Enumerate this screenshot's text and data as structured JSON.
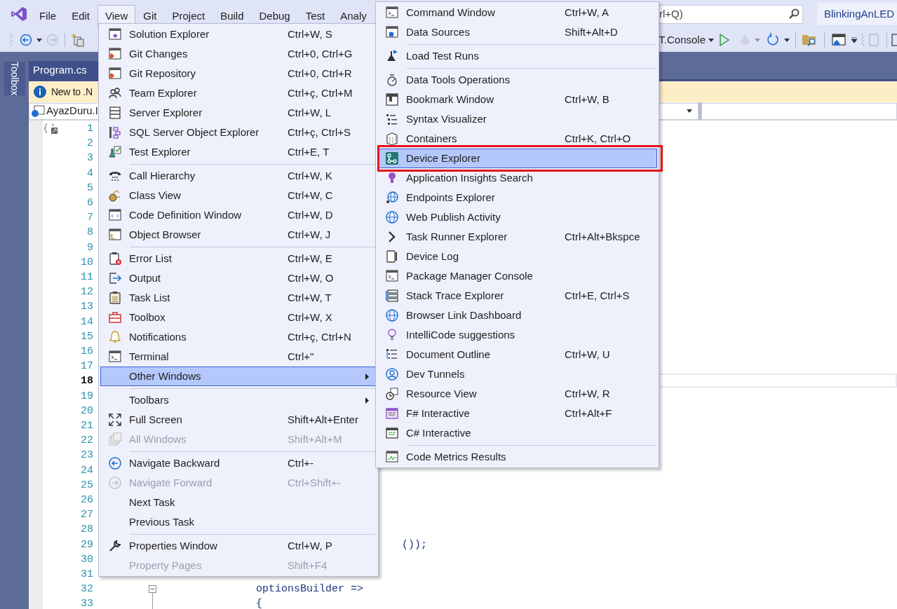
{
  "menu_bar": [
    {
      "label": "File",
      "selected": false
    },
    {
      "label": "Edit",
      "selected": false
    },
    {
      "label": "View",
      "selected": true
    },
    {
      "label": "Git",
      "selected": false
    },
    {
      "label": "Project",
      "selected": false
    },
    {
      "label": "Build",
      "selected": false
    },
    {
      "label": "Debug",
      "selected": false
    },
    {
      "label": "Test",
      "selected": false
    },
    {
      "label": "Analy",
      "selected": false
    }
  ],
  "search": {
    "placeholder": "rl+Q)"
  },
  "solution_name": "BlinkingAnLED",
  "toolbar": {
    "startup_project": "T.Console"
  },
  "side_tab": "Toolbox",
  "document_tab": {
    "label": "Program.cs",
    "selected": true
  },
  "info_bar": {
    "text": "New to .N"
  },
  "navigation_bar": {
    "project": "AyazDuru.I"
  },
  "editor": {
    "lines": [
      {
        "number": "1",
        "current": false
      },
      {
        "number": "2",
        "current": false
      },
      {
        "number": "3",
        "current": false
      },
      {
        "number": "4",
        "current": false
      },
      {
        "number": "5",
        "current": false
      },
      {
        "number": "6",
        "current": false
      },
      {
        "number": "7",
        "current": false
      },
      {
        "number": "8",
        "current": false
      },
      {
        "number": "9",
        "current": false
      },
      {
        "number": "10",
        "current": false
      },
      {
        "number": "11",
        "current": false
      },
      {
        "number": "12",
        "current": false
      },
      {
        "number": "13",
        "current": false
      },
      {
        "number": "14",
        "current": false
      },
      {
        "number": "15",
        "current": false
      },
      {
        "number": "16",
        "current": false
      },
      {
        "number": "17",
        "current": false
      },
      {
        "number": "18",
        "current": true
      },
      {
        "number": "19",
        "current": false
      },
      {
        "number": "20",
        "current": false
      },
      {
        "number": "21",
        "current": false
      },
      {
        "number": "22",
        "current": false
      },
      {
        "number": "23",
        "current": false
      },
      {
        "number": "24",
        "current": false
      },
      {
        "number": "25",
        "current": false
      },
      {
        "number": "26",
        "current": false
      },
      {
        "number": "27",
        "current": false
      },
      {
        "number": "28",
        "current": false
      },
      {
        "number": "29",
        "current": false,
        "code": "());"
      },
      {
        "number": "30",
        "current": false
      },
      {
        "number": "31",
        "current": false
      },
      {
        "number": "32",
        "current": false,
        "code": "optionsBuilder =>",
        "collapsible": true
      },
      {
        "number": "33",
        "current": false,
        "code": "{"
      }
    ]
  },
  "view_menu": {
    "groups": [
      [
        {
          "label": "Solution Explorer",
          "shortcut": "Ctrl+W, S",
          "selected": false,
          "disabled": false
        },
        {
          "label": "Git Changes",
          "shortcut": "Ctrl+0, Ctrl+G",
          "selected": false,
          "disabled": false
        },
        {
          "label": "Git Repository",
          "shortcut": "Ctrl+0, Ctrl+R",
          "selected": false,
          "disabled": false
        },
        {
          "label": "Team Explorer",
          "shortcut": "Ctrl+ç, Ctrl+M",
          "selected": false,
          "disabled": false
        },
        {
          "label": "Server Explorer",
          "shortcut": "Ctrl+W, L",
          "selected": false,
          "disabled": false
        },
        {
          "label": "SQL Server Object Explorer",
          "shortcut": "Ctrl+ç, Ctrl+S",
          "selected": false,
          "disabled": false
        },
        {
          "label": "Test Explorer",
          "shortcut": "Ctrl+E, T",
          "selected": false,
          "disabled": false
        }
      ],
      [
        {
          "label": "Call Hierarchy",
          "shortcut": "Ctrl+W, K",
          "selected": false,
          "disabled": false
        },
        {
          "label": "Class View",
          "shortcut": "Ctrl+W, C",
          "selected": false,
          "disabled": false
        },
        {
          "label": "Code Definition Window",
          "shortcut": "Ctrl+W, D",
          "selected": false,
          "disabled": false
        },
        {
          "label": "Object Browser",
          "shortcut": "Ctrl+W, J",
          "selected": false,
          "disabled": false
        }
      ],
      [
        {
          "label": "Error List",
          "shortcut": "Ctrl+W, E",
          "selected": false,
          "disabled": false
        },
        {
          "label": "Output",
          "shortcut": "Ctrl+W, O",
          "selected": false,
          "disabled": false
        },
        {
          "label": "Task List",
          "shortcut": "Ctrl+W, T",
          "selected": false,
          "disabled": false
        },
        {
          "label": "Toolbox",
          "shortcut": "Ctrl+W, X",
          "selected": false,
          "disabled": false
        },
        {
          "label": "Notifications",
          "shortcut": "Ctrl+ç, Ctrl+N",
          "selected": false,
          "disabled": false
        },
        {
          "label": "Terminal",
          "shortcut": "Ctrl+\"",
          "selected": false,
          "disabled": false
        },
        {
          "label": "Other Windows",
          "selected": true,
          "disabled": false,
          "has_submenu": true
        }
      ],
      [
        {
          "label": "Toolbars",
          "selected": false,
          "disabled": false,
          "has_submenu": true
        },
        {
          "label": "Full Screen",
          "shortcut": "Shift+Alt+Enter",
          "selected": false,
          "disabled": false
        },
        {
          "label": "All Windows",
          "shortcut": "Shift+Alt+M",
          "selected": false,
          "disabled": true
        }
      ],
      [
        {
          "label": "Navigate Backward",
          "shortcut": "Ctrl+-",
          "selected": false,
          "disabled": false
        },
        {
          "label": "Navigate Forward",
          "shortcut": "Ctrl+Shift+-",
          "selected": false,
          "disabled": true
        },
        {
          "label": "Next Task",
          "selected": false,
          "disabled": false
        },
        {
          "label": "Previous Task",
          "selected": false,
          "disabled": false
        }
      ],
      [
        {
          "label": "Properties Window",
          "shortcut": "Ctrl+W, P",
          "selected": false,
          "disabled": false
        },
        {
          "label": "Property Pages",
          "shortcut": "Shift+F4",
          "selected": false,
          "disabled": true
        }
      ]
    ]
  },
  "other_windows_menu": {
    "groups": [
      [
        {
          "label": "Command Window",
          "shortcut": "Ctrl+W, A",
          "selected": false
        },
        {
          "label": "Data Sources",
          "shortcut": "Shift+Alt+D",
          "selected": false
        }
      ],
      [
        {
          "label": "Load Test Runs",
          "selected": false
        }
      ],
      [
        {
          "label": "Data Tools Operations",
          "selected": false
        },
        {
          "label": "Bookmark Window",
          "shortcut": "Ctrl+W, B",
          "selected": false
        },
        {
          "label": "Syntax Visualizer",
          "selected": false
        },
        {
          "label": "Containers",
          "shortcut": "Ctrl+K, Ctrl+O",
          "selected": false
        },
        {
          "label": "Device Explorer",
          "selected": true,
          "annotated": true
        },
        {
          "label": "Application Insights Search",
          "selected": false
        },
        {
          "label": "Endpoints Explorer",
          "selected": false
        },
        {
          "label": "Web Publish Activity",
          "selected": false
        },
        {
          "label": "Task Runner Explorer",
          "shortcut": "Ctrl+Alt+Bkspce",
          "selected": false
        },
        {
          "label": "Device Log",
          "selected": false
        },
        {
          "label": "Package Manager Console",
          "selected": false
        },
        {
          "label": "Stack Trace Explorer",
          "shortcut": "Ctrl+E, Ctrl+S",
          "selected": false
        },
        {
          "label": "Browser Link Dashboard",
          "selected": false
        },
        {
          "label": "IntelliCode suggestions",
          "selected": false
        },
        {
          "label": "Document Outline",
          "shortcut": "Ctrl+W, U",
          "selected": false
        },
        {
          "label": "Dev Tunnels",
          "selected": false
        },
        {
          "label": "Resource View",
          "shortcut": "Ctrl+W, R",
          "selected": false
        },
        {
          "label": "F# Interactive",
          "shortcut": "Ctrl+Alt+F",
          "selected": false
        },
        {
          "label": "C# Interactive",
          "selected": false
        }
      ],
      [
        {
          "label": "Code Metrics Results",
          "selected": false
        }
      ]
    ]
  }
}
